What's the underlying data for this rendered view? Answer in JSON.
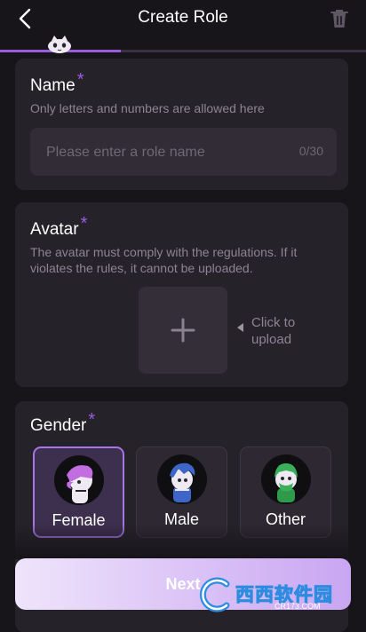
{
  "header": {
    "title": "Create Role",
    "back_icon": "chevron-left-icon",
    "delete_icon": "trash-icon"
  },
  "progress": {
    "fraction": 0.33,
    "color": "#9a5de0"
  },
  "name_section": {
    "label": "Name",
    "required_mark": "*",
    "hint": "Only letters and numbers are allowed here",
    "input_value": "",
    "input_placeholder": "Please enter a role name",
    "counter": "0/30"
  },
  "avatar_section": {
    "label": "Avatar",
    "required_mark": "*",
    "hint": "The avatar must comply with the regulations. If it violates the rules, it cannot be uploaded.",
    "upload_hint": "Click to upload"
  },
  "gender_section": {
    "label": "Gender",
    "required_mark": "*",
    "options": [
      {
        "label": "Female",
        "selected": true
      },
      {
        "label": "Male",
        "selected": false
      },
      {
        "label": "Other",
        "selected": false
      }
    ]
  },
  "next_button": {
    "label": "Next"
  },
  "watermark": {
    "text": "西西软件园",
    "sub": "CR173.COM"
  },
  "colors": {
    "accent": "#9a5de0",
    "background": "#17141a",
    "card": "#262229"
  }
}
